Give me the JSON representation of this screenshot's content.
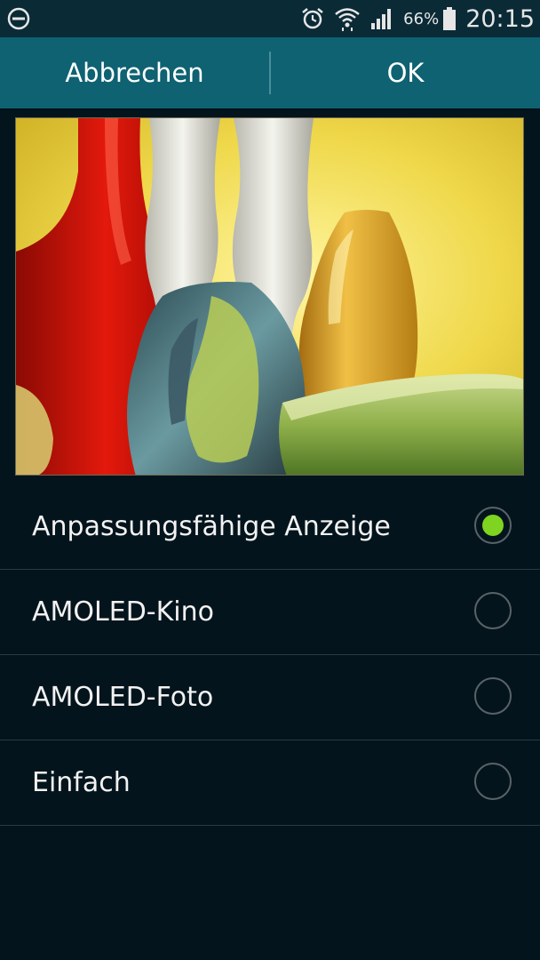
{
  "status_bar": {
    "left_icon": "do-not-disturb-icon",
    "icons": [
      "alarm-icon",
      "wifi-icon",
      "signal-icon"
    ],
    "battery_percent": "66%",
    "battery_icon": "battery-icon",
    "time": "20:15"
  },
  "action_bar": {
    "cancel_label": "Abbrechen",
    "ok_label": "OK"
  },
  "preview": {
    "image": "glass-vases-preview-image"
  },
  "options": [
    {
      "label": "Anpassungsfähige Anzeige",
      "selected": true
    },
    {
      "label": "AMOLED-Kino",
      "selected": false
    },
    {
      "label": "AMOLED-Foto",
      "selected": false
    },
    {
      "label": "Einfach",
      "selected": false
    }
  ],
  "colors": {
    "action_bar": "#0e6272",
    "background": "#03141c",
    "radio_selected": "#7fd321"
  }
}
